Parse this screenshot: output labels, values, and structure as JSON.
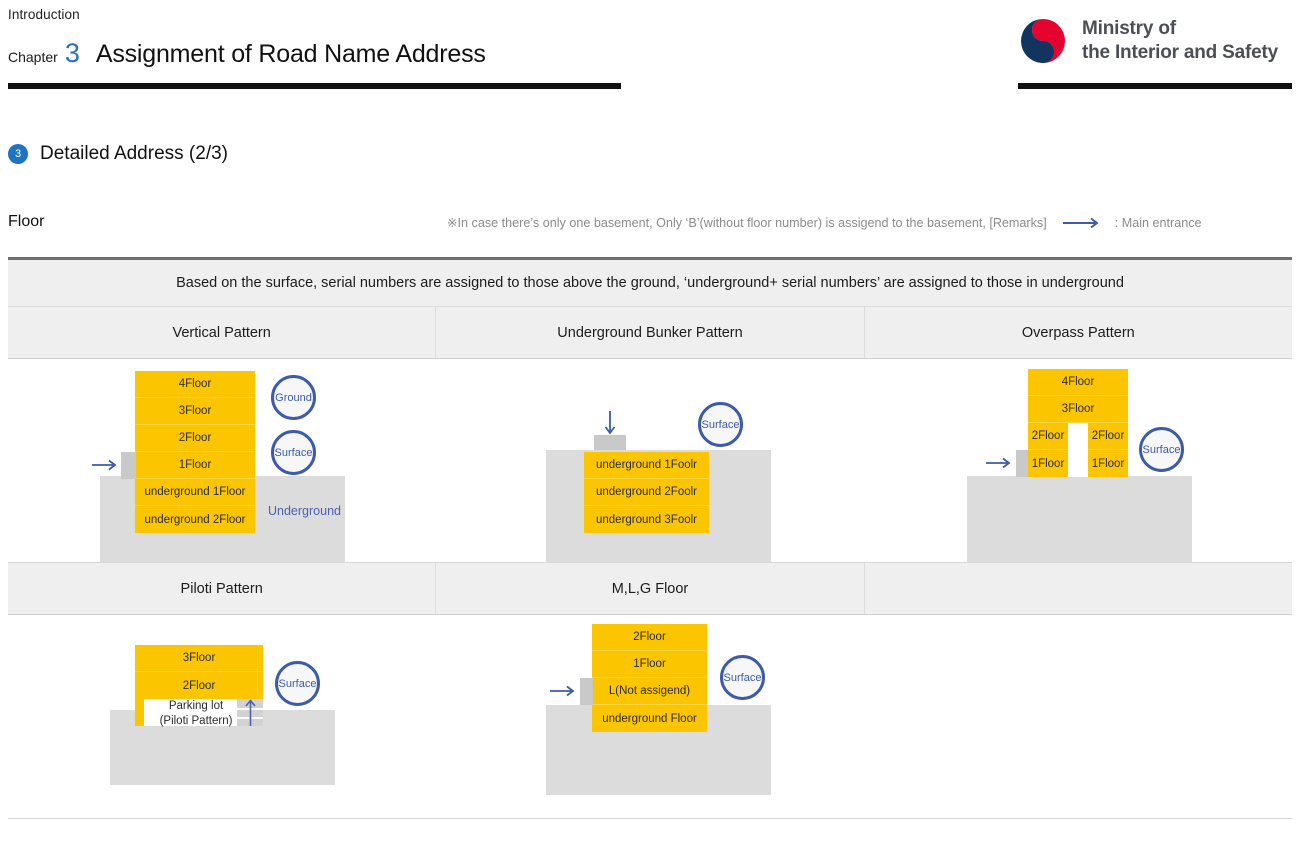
{
  "header": {
    "intro_label": "Introduction",
    "chapter_word": "Chapter",
    "chapter_number": "3",
    "chapter_title": "Assignment of Road Name Address",
    "logo_line1": "Ministry of",
    "logo_line2": "the Interior and Safety",
    "rule_color": "#111111",
    "accent_blue": "#2b6fc2"
  },
  "section": {
    "bullet": "3",
    "title": "Detailed Address (2/3)",
    "bullet_color": "#2072c3"
  },
  "floor": {
    "label": "Floor",
    "note": "※In case there’s only one basement, Only ‘B’(without floor number) is assigend to the basement, [Remarks]",
    "note_arrow_icon": "right-arrow-icon",
    "note_entrance": ": Main entrance"
  },
  "table": {
    "banner": "Based on the surface, serial numbers are assigned to those above the ground, ‘underground+ serial numbers’ are assigned to those in underground",
    "headers_row1": [
      "Vertical Pattern",
      "Underground Bunker Pattern",
      "Overpass Pattern"
    ],
    "headers_row2": [
      "Piloti  Pattern",
      "M,L,G Floor",
      ""
    ]
  },
  "diagrams": {
    "vertical": {
      "name": "Vertical Pattern",
      "above_floors": [
        "4Floor",
        "3Floor",
        "2Floor",
        "1Floor"
      ],
      "below_floors": [
        "underground 1Floor",
        "underground 2Floor"
      ],
      "badges": [
        "Ground",
        "Surface"
      ],
      "underground_caption": "Underground",
      "entrance_icon": "main-entrance-arrow-icon"
    },
    "bunker": {
      "name": "Underground Bunker Pattern",
      "below_floors": [
        "underground 1Foolr",
        "underground 2Foolr",
        "underground 3Foolr"
      ],
      "badges": [
        "Surface"
      ],
      "entrance_icon": "down-entrance-arrow-icon"
    },
    "overpass": {
      "name": "Overpass Pattern",
      "full_floors": [
        "4Floor",
        "3Floor"
      ],
      "split_floors_left": [
        "2Floor",
        "1Floor"
      ],
      "split_floors_right": [
        "2Floor",
        "1Floor"
      ],
      "badges": [
        "Surface"
      ],
      "entrance_icon": "main-entrance-arrow-icon"
    },
    "piloti": {
      "name": "Piloti Pattern",
      "above_floors": [
        "3Floor",
        "2Floor"
      ],
      "parking_text_line1": "Parking lot",
      "parking_text_line2": "(Piloti Pattern)",
      "badges": [
        "Surface"
      ],
      "stair_icon": "up-arrow-icon"
    },
    "mlg": {
      "name": "M,L,G Floor",
      "floors": [
        "2Floor",
        "1Floor",
        "L(Not assigend)",
        "underground Floor"
      ],
      "badges": [
        "Surface"
      ],
      "entrance_icon": "main-entrance-arrow-icon"
    }
  },
  "colors": {
    "yellow": "#fbc500",
    "ground_gray": "#dcdcdc",
    "door_gray": "#c9c9c9",
    "badge_blue": "#3c5ba9",
    "header_bg": "#efefef"
  }
}
